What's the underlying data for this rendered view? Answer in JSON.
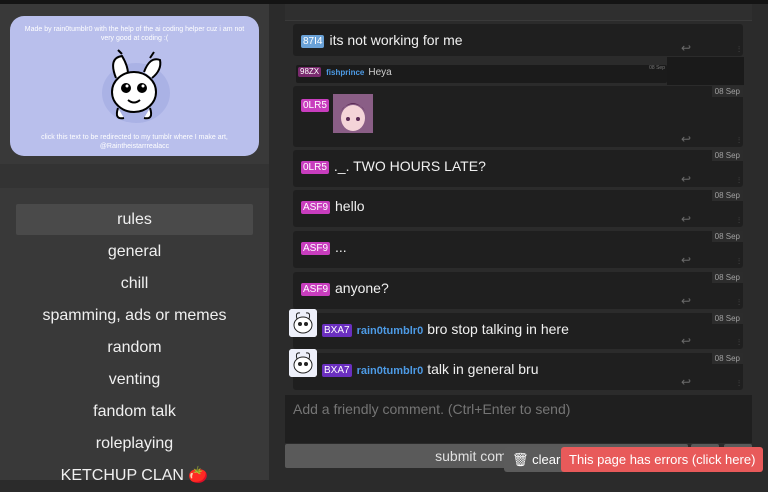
{
  "banner": {
    "top_text": "Made by rain0tumblr0 with the help of the ai coding helper cuz i am not very good at coding :(",
    "bottom_text": "click this text to be redirected to my tumblr where I make art, @Raintheistarrrealacc"
  },
  "nav": {
    "items": [
      {
        "label": "rules",
        "active": true
      },
      {
        "label": "general"
      },
      {
        "label": "chill"
      },
      {
        "label": "spamming, ads or memes"
      },
      {
        "label": "random"
      },
      {
        "label": "venting"
      },
      {
        "label": "fandom talk"
      },
      {
        "label": "roleplaying"
      },
      {
        "label": "KETCHUP CLAN 🍅"
      }
    ]
  },
  "messages": [
    {
      "tag": "87I4",
      "text": "its not working for me"
    },
    {
      "tag": "0LR5",
      "text": "",
      "date": "08 Sep",
      "has_image": true
    },
    {
      "tag": "0LR5",
      "text": "._. TWO HOURS LATE?",
      "date": "08 Sep"
    },
    {
      "tag": "ASF9",
      "text": "hello",
      "date": "08 Sep"
    },
    {
      "tag": "ASF9",
      "text": "...",
      "date": "08 Sep"
    },
    {
      "tag": "ASF9",
      "text": "anyone?",
      "date": "08 Sep"
    },
    {
      "tag": "BXA7",
      "user": "rain0tumblr0",
      "text": "bro stop talking in here",
      "date": "08 Sep"
    },
    {
      "tag": "BXA7",
      "user": "rain0tumblr0",
      "text": "talk in general bru",
      "date": "08 Sep"
    }
  ],
  "nested_reply": {
    "tag": "98ZX",
    "user": "fishprince",
    "text": "Heya",
    "date": "08 Sep"
  },
  "glyphs": {
    "reply": "↩",
    "more": "⫶"
  },
  "composer": {
    "placeholder": "Add a friendly comment. (Ctrl+Enter to send)",
    "submit_label": "submit comment"
  },
  "footer": {
    "clear_label": "🗑 clear",
    "errors_label": "This page has errors (click here)"
  },
  "colors": {
    "banner": "#b9bfec",
    "error": "#e85a5a",
    "tag_pink": "#c83dbe",
    "tag_purple": "#6b2fc0",
    "user_link": "#4d9be6"
  }
}
